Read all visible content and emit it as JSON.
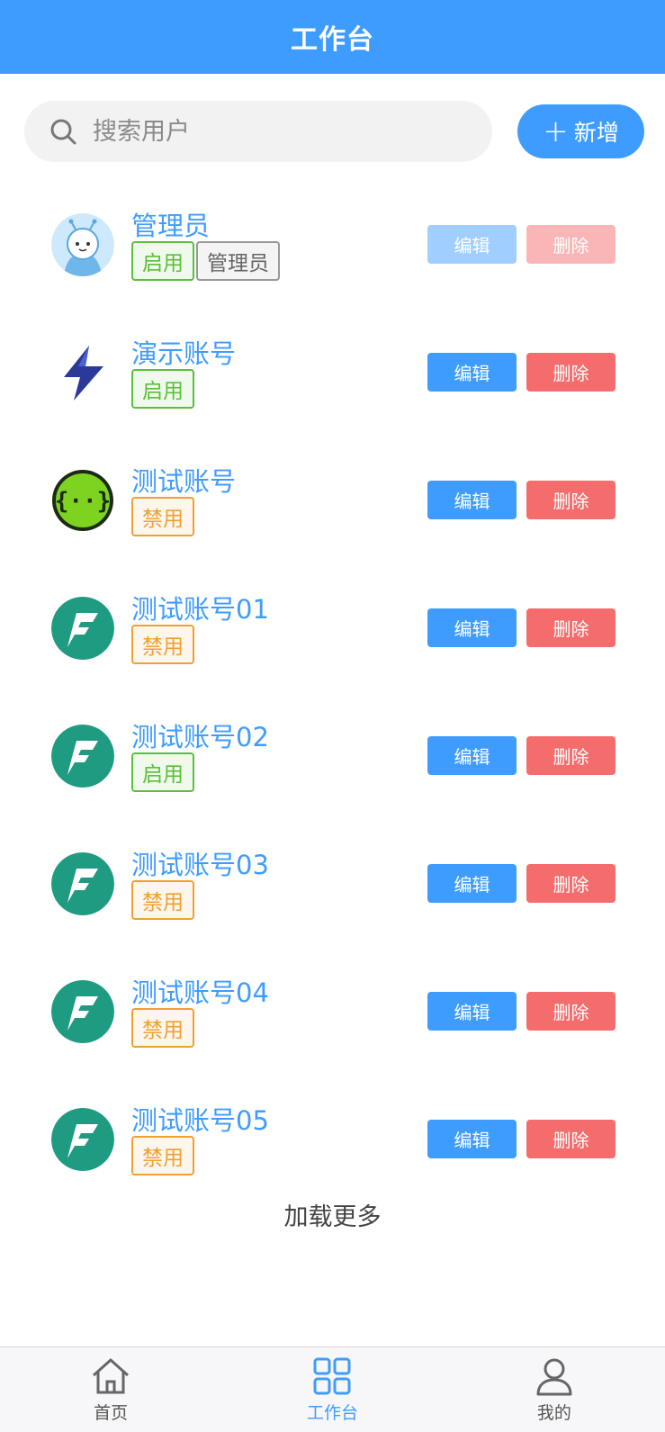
{
  "header": {
    "title": "工作台"
  },
  "search": {
    "placeholder": "搜索用户",
    "value": ""
  },
  "toolbar": {
    "add_label": "新增"
  },
  "actions": {
    "edit_label": "编辑",
    "delete_label": "删除"
  },
  "users": [
    {
      "name": "管理员",
      "status": "启用",
      "role": "管理员",
      "avatar": "cartoon-avatar",
      "actions_disabled": true
    },
    {
      "name": "演示账号",
      "status": "启用",
      "avatar": "lightning-bolt-avatar"
    },
    {
      "name": "测试账号",
      "status": "禁用",
      "avatar": "code-braces-avatar"
    },
    {
      "name": "测试账号01",
      "status": "禁用",
      "avatar": "teal-f-logo-avatar"
    },
    {
      "name": "测试账号02",
      "status": "启用",
      "avatar": "teal-f-logo-avatar"
    },
    {
      "name": "测试账号03",
      "status": "禁用",
      "avatar": "teal-f-logo-avatar"
    },
    {
      "name": "测试账号04",
      "status": "禁用",
      "avatar": "teal-f-logo-avatar"
    },
    {
      "name": "测试账号05",
      "status": "禁用",
      "avatar": "teal-f-logo-avatar"
    }
  ],
  "load_more": "加载更多",
  "tabbar": {
    "items": [
      {
        "label": "首页",
        "icon": "home-icon"
      },
      {
        "label": "工作台",
        "icon": "grid-icon",
        "active": true
      },
      {
        "label": "我的",
        "icon": "user-icon"
      }
    ]
  },
  "colors": {
    "primary": "#3f9cff",
    "danger": "#f56c6c",
    "enabled": "#5bbf3a",
    "disabled": "#f0a030"
  }
}
